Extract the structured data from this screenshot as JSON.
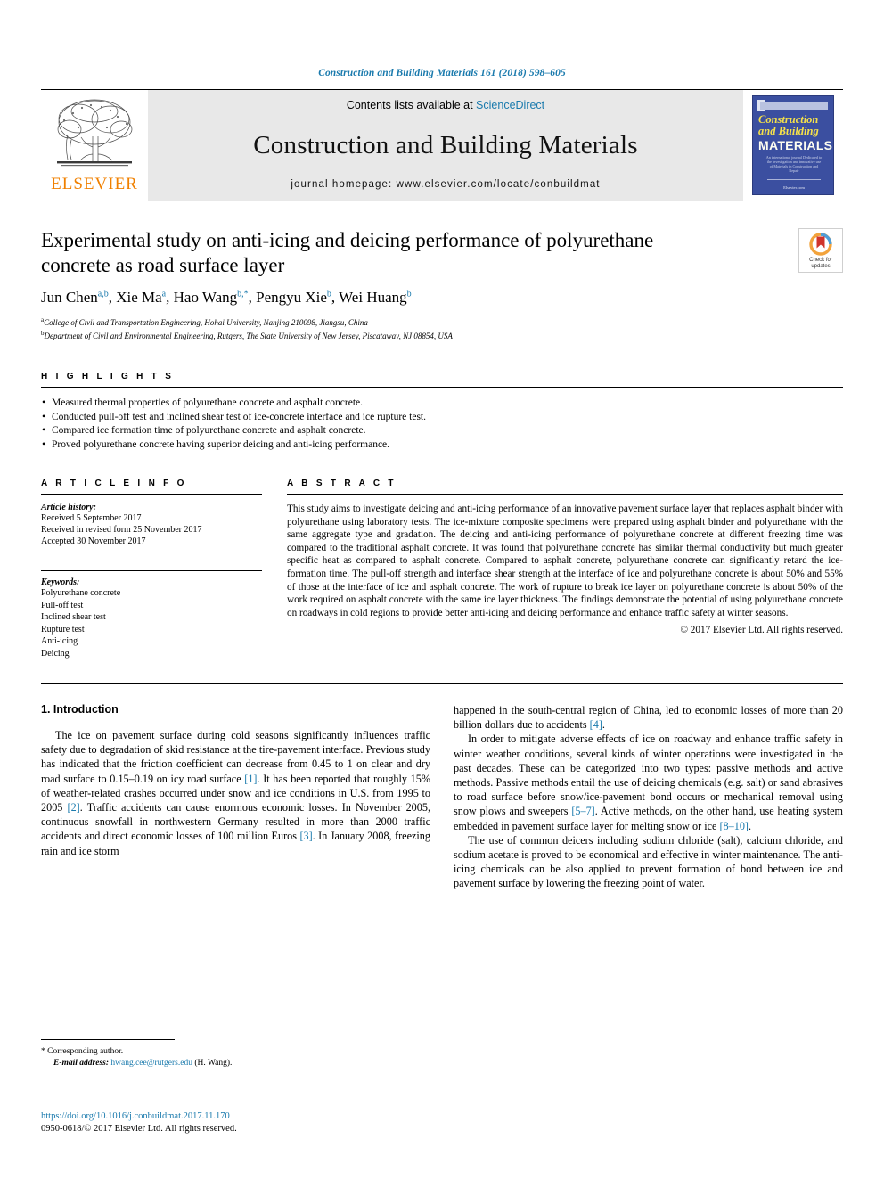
{
  "running_head": "Construction and Building Materials 161 (2018) 598–605",
  "masthead": {
    "publisher_name": "ELSEVIER",
    "contents_prefix": "Contents lists available at ",
    "contents_link": "ScienceDirect",
    "journal_name": "Construction and Building Materials",
    "homepage": "journal homepage: www.elsevier.com/locate/conbuildmat",
    "cover": {
      "line1": "Construction",
      "line2": "and Building",
      "line3": "MATERIALS",
      "blurb": "An international journal Dedicated to the Investigation and innovative use of Materials in Construction and Repair",
      "foot": "Elsevier.com"
    }
  },
  "article": {
    "title": "Experimental study on anti-icing and deicing performance of polyurethane concrete as road surface layer",
    "authors_html": "Jun Chen<sup>a,b</sup>, Xie Ma<sup>a</sup>, Hao Wang<sup>b,*</sup>, Pengyu Xie<sup>b</sup>, Wei Huang<sup>b</sup>",
    "affiliation_a": "College of Civil and Transportation Engineering, Hohai University, Nanjing 210098, Jiangsu, China",
    "affiliation_b": "Department of Civil and Environmental Engineering, Rutgers, The State University of New Jersey, Piscataway, NJ 08854, USA",
    "crossmark_label": "Check for\nupdates"
  },
  "highlights": {
    "heading": "H I G H L I G H T S",
    "items": [
      "Measured thermal properties of polyurethane concrete and asphalt concrete.",
      "Conducted pull-off test and inclined shear test of ice-concrete interface and ice rupture test.",
      "Compared ice formation time of polyurethane concrete and asphalt concrete.",
      "Proved polyurethane concrete having superior deicing and anti-icing performance."
    ]
  },
  "article_info": {
    "heading": "A R T I C L E   I N F O",
    "history_label": "Article history:",
    "history": [
      "Received 5 September 2017",
      "Received in revised form 25 November 2017",
      "Accepted 30 November 2017"
    ],
    "keywords_label": "Keywords:",
    "keywords": [
      "Polyurethane concrete",
      "Pull-off test",
      "Inclined shear test",
      "Rupture test",
      "Anti-icing",
      "Deicing"
    ]
  },
  "abstract": {
    "heading": "A B S T R A C T",
    "text": "This study aims to investigate deicing and anti-icing performance of an innovative pavement surface layer that replaces asphalt binder with polyurethane using laboratory tests. The ice-mixture composite specimens were prepared using asphalt binder and polyurethane with the same aggregate type and gradation. The deicing and anti-icing performance of polyurethane concrete at different freezing time was compared to the traditional asphalt concrete. It was found that polyurethane concrete has similar thermal conductivity but much greater specific heat as compared to asphalt concrete. Compared to asphalt concrete, polyurethane concrete can significantly retard the ice-formation time. The pull-off strength and interface shear strength at the interface of ice and polyurethane concrete is about 50% and 55% of those at the interface of ice and asphalt concrete. The work of rupture to break ice layer on polyurethane concrete is about 50% of the work required on asphalt concrete with the same ice layer thickness. The findings demonstrate the potential of using polyurethane concrete on roadways in cold regions to provide better anti-icing and deicing performance and enhance traffic safety at winter seasons.",
    "copyright": "© 2017 Elsevier Ltd. All rights reserved."
  },
  "body": {
    "section_heading": "1. Introduction",
    "left_paragraphs": [
      {
        "segments": [
          {
            "t": "The ice on pavement surface during cold seasons significantly influences traffic safety due to degradation of skid resistance at the tire-pavement interface. Previous study has indicated that the friction coefficient can decrease from 0.45 to 1 on clear and dry road surface to 0.15–0.19 on icy road surface "
          },
          {
            "t": "[1]",
            "ref": true
          },
          {
            "t": ". It has been reported that roughly 15% of weather-related crashes occurred under snow and ice conditions in U.S. from 1995 to 2005 "
          },
          {
            "t": "[2]",
            "ref": true
          },
          {
            "t": ". Traffic accidents can cause enormous economic losses. In November 2005, continuous snowfall in northwestern Germany resulted in more than 2000 traffic accidents and direct economic losses of 100 million Euros "
          },
          {
            "t": "[3]",
            "ref": true
          },
          {
            "t": ". In January 2008, freezing rain and ice storm"
          }
        ]
      }
    ],
    "right_paragraphs": [
      {
        "indent": false,
        "segments": [
          {
            "t": "happened in the south-central region of China, led to economic losses of more than 20 billion dollars due to accidents "
          },
          {
            "t": "[4]",
            "ref": true
          },
          {
            "t": "."
          }
        ]
      },
      {
        "indent": true,
        "segments": [
          {
            "t": "In order to mitigate adverse effects of ice on roadway and enhance traffic safety in winter weather conditions, several kinds of winter operations were investigated in the past decades. These can be categorized into two types: passive methods and active methods. Passive methods entail the use of deicing chemicals (e.g. salt) or sand abrasives to road surface before snow/ice-pavement bond occurs or mechanical removal using snow plows and sweepers "
          },
          {
            "t": "[5–7]",
            "ref": true
          },
          {
            "t": ". Active methods, on the other hand, use heating system embedded in pavement surface layer for melting snow or ice "
          },
          {
            "t": "[8–10]",
            "ref": true
          },
          {
            "t": "."
          }
        ]
      },
      {
        "indent": true,
        "segments": [
          {
            "t": "The use of common deicers including sodium chloride (salt), calcium chloride, and sodium acetate is proved to be economical and effective in winter maintenance. The anti-icing chemicals can be also applied to prevent formation of bond between ice and pavement surface by lowering the freezing point of water."
          }
        ]
      }
    ]
  },
  "footnote": {
    "corresponding": "* Corresponding author.",
    "email_label": "E-mail address:",
    "email": "hwang.cee@rutgers.edu",
    "email_suffix": " (H. Wang)."
  },
  "footer": {
    "doi": "https://doi.org/10.1016/j.conbuildmat.2017.11.170",
    "issn": "0950-0618/© 2017 Elsevier Ltd. All rights reserved."
  },
  "colors": {
    "link": "#1a7aad",
    "elsevier_orange": "#f08000",
    "cover_blue": "#3b4fa0",
    "masthead_grey": "#e8e8e8"
  }
}
